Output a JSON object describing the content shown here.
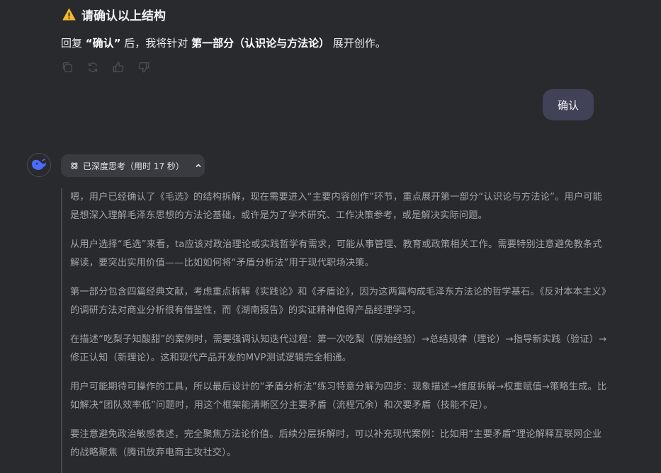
{
  "heading": {
    "title": "请确认以上结构"
  },
  "reply": {
    "prefix": "回复",
    "keyword": "“确认”",
    "middle": "后，我将针对",
    "section": "第一部分（认识论与方法论）",
    "suffix": "展开创作。"
  },
  "actions": {
    "icons": [
      "copy-icon",
      "regenerate-icon",
      "thumbs-up-icon",
      "thumbs-down-icon"
    ]
  },
  "user_message": {
    "text": "确认"
  },
  "thinking": {
    "chip_label": "已深度思考（用时 17 秒）",
    "paragraphs": [
      "嗯，用户已经确认了《毛选》的结构拆解，现在需要进入“主要内容创作”环节，重点展开第一部分“认识论与方法论”。用户可能是想深入理解毛泽东思想的方法论基础，或许是为了学术研究、工作决策参考，或是解决实际问题。",
      "从用户选择“毛选”来看，ta应该对政治理论或实践哲学有需求，可能从事管理、教育或政策相关工作。需要特别注意避免教条式解读，要突出实用价值——比如如何将“矛盾分析法”用于现代职场决策。",
      "第一部分包含四篇经典文献，考虑重点拆解《实践论》和《矛盾论》，因为这两篇构成毛泽东方法论的哲学基石。《反对本本主义》的调研方法对商业分析很有借鉴性，而《湖南报告》的实证精神值得产品经理学习。",
      "在描述“吃梨子知酸甜”的案例时，需要强调认知迭代过程：第一次吃梨（原始经验）→总结规律（理论）→指导新实践（验证）→修正认知（新理论）。这和现代产品开发的MVP测试逻辑完全相通。",
      "用户可能期待可操作的工具，所以最后设计的“矛盾分析法”练习特意分解为四步：现象描述→维度拆解→权重赋值→策略生成。比如解决“团队效率低”问题时，用这个框架能清晰区分主要矛盾（流程冗余）和次要矛盾（技能不足）。",
      "要注意避免政治敏感表述，完全聚焦方法论价值。后续分层拆解时，可以补充现代案例：比如用“主要矛盾”理论解释互联网企业的战略聚焦（腾讯放弃电商主攻社交）。"
    ]
  },
  "colors": {
    "background": "#292a2d",
    "user_bubble": "#414158",
    "chip": "#3a3b40",
    "thinking_text": "#a3a4aa",
    "warning": "#f5b82e",
    "brand": "#4d6bfe"
  }
}
